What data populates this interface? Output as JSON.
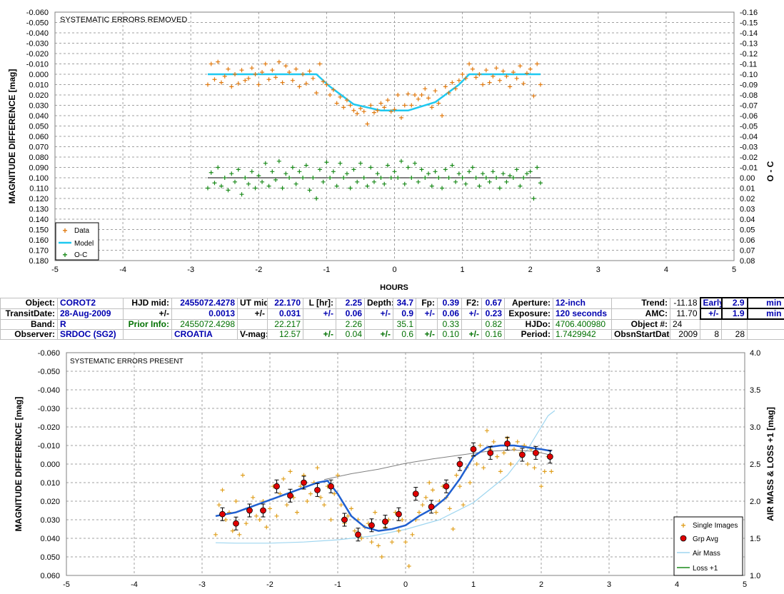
{
  "colors": {
    "data": "#e07a10",
    "model": "#1ec8f0",
    "oc": "#1a8a1a",
    "grpavg": "#e00000",
    "fit": "#2060d0",
    "airmass": "#9fd6f0",
    "loss": "#808080",
    "grid": "#a0a0a0"
  },
  "chart_data": [
    {
      "type": "scatter",
      "title": "SYSTEMATIC ERRORS REMOVED",
      "xlabel": "HOURS",
      "ylabel": "MAGNITUDE DIFFERENCE [mag]",
      "y2label": "O - C",
      "xlim": [
        -5,
        5
      ],
      "ylim": [
        -0.06,
        0.18
      ],
      "y_inverted": true,
      "y2lim": [
        -0.16,
        0.08
      ],
      "y2_inverted": true,
      "xticks": [
        "-5",
        "-4",
        "-3",
        "-2",
        "-1",
        "0",
        "1",
        "2",
        "3",
        "4",
        "5"
      ],
      "yticks": [
        "-0.060",
        "-0.050",
        "-0.040",
        "-0.030",
        "-0.020",
        "-0.010",
        "0.000",
        "0.010",
        "0.020",
        "0.030",
        "0.040",
        "0.050",
        "0.060",
        "0.070",
        "0.080",
        "0.090",
        "0.100",
        "0.110",
        "0.120",
        "0.130",
        "0.140",
        "0.150",
        "0.160",
        "0.170",
        "0.180"
      ],
      "y2ticks": [
        "-0.16",
        "-0.15",
        "-0.14",
        "-0.13",
        "-0.12",
        "-0.11",
        "-0.10",
        "-0.09",
        "-0.08",
        "-0.07",
        "-0.06",
        "-0.05",
        "-0.04",
        "-0.03",
        "-0.02",
        "-0.01",
        "0.00",
        "0.01",
        "0.02",
        "0.03",
        "0.04",
        "0.05",
        "0.06",
        "0.07",
        "0.08"
      ],
      "grid": true,
      "legend_position": "bottom-left",
      "legend": [
        "Data",
        "Model",
        "O-C"
      ],
      "model": {
        "name": "Model",
        "x": [
          -2.75,
          -1.15,
          -0.95,
          -0.6,
          -0.2,
          0.2,
          0.6,
          0.95,
          1.1,
          2.15
        ],
        "y": [
          0.0,
          0.0,
          0.012,
          0.029,
          0.035,
          0.035,
          0.027,
          0.01,
          0.0,
          0.0
        ]
      },
      "oc_baseline": {
        "x": [
          -2.75,
          2.15
        ],
        "y": [
          0.1,
          0.1
        ]
      },
      "series": [
        {
          "name": "Data",
          "x": [
            -2.75,
            -2.7,
            -2.65,
            -2.6,
            -2.55,
            -2.5,
            -2.45,
            -2.4,
            -2.35,
            -2.3,
            -2.25,
            -2.2,
            -2.15,
            -2.1,
            -2.05,
            -2.0,
            -1.95,
            -1.9,
            -1.85,
            -1.8,
            -1.75,
            -1.7,
            -1.65,
            -1.6,
            -1.55,
            -1.5,
            -1.45,
            -1.4,
            -1.35,
            -1.3,
            -1.25,
            -1.2,
            -1.15,
            -1.1,
            -1.05,
            -1.0,
            -0.95,
            -0.9,
            -0.85,
            -0.8,
            -0.75,
            -0.7,
            -0.65,
            -0.6,
            -0.55,
            -0.5,
            -0.45,
            -0.4,
            -0.35,
            -0.3,
            -0.25,
            -0.2,
            -0.15,
            -0.1,
            -0.05,
            0.0,
            0.05,
            0.1,
            0.15,
            0.2,
            0.25,
            0.3,
            0.35,
            0.4,
            0.45,
            0.5,
            0.55,
            0.6,
            0.65,
            0.7,
            0.75,
            0.8,
            0.85,
            0.9,
            0.95,
            1.0,
            1.05,
            1.1,
            1.15,
            1.2,
            1.25,
            1.3,
            1.35,
            1.4,
            1.45,
            1.5,
            1.55,
            1.6,
            1.65,
            1.7,
            1.75,
            1.8,
            1.85,
            1.9,
            1.95,
            2.0,
            2.05,
            2.1,
            2.15
          ],
          "y": [
            0.01,
            -0.01,
            0.005,
            -0.012,
            0.008,
            0.002,
            -0.005,
            0.012,
            0.0,
            0.009,
            -0.004,
            0.006,
            0.004,
            -0.006,
            0.0,
            0.01,
            -0.002,
            -0.01,
            0.005,
            -0.004,
            0.003,
            -0.012,
            0.008,
            -0.008,
            -0.002,
            0.006,
            -0.005,
            0.012,
            0.0,
            0.009,
            -0.003,
            0.004,
            0.018,
            -0.01,
            0.007,
            0.01,
            0.02,
            0.015,
            0.028,
            0.022,
            0.032,
            0.025,
            0.03,
            0.035,
            0.038,
            0.033,
            0.036,
            0.048,
            0.03,
            0.037,
            0.035,
            0.028,
            0.032,
            0.025,
            0.036,
            0.034,
            0.02,
            0.042,
            0.03,
            0.019,
            0.03,
            0.02,
            0.024,
            0.02,
            0.014,
            0.023,
            0.032,
            0.016,
            0.028,
            0.04,
            0.012,
            0.018,
            0.008,
            0.014,
            0.006,
            0.0,
            0.004,
            -0.01,
            -0.005,
            0.003,
            0.0,
            0.01,
            -0.004,
            0.008,
            0.002,
            -0.006,
            0.006,
            -0.003,
            0.002,
            0.012,
            -0.002,
            0.004,
            -0.008,
            0.009,
            -0.001,
            -0.005,
            0.021,
            -0.01,
            0.01
          ]
        },
        {
          "name": "O-C",
          "x": [
            -2.75,
            -2.7,
            -2.65,
            -2.6,
            -2.55,
            -2.5,
            -2.45,
            -2.4,
            -2.35,
            -2.3,
            -2.25,
            -2.2,
            -2.15,
            -2.1,
            -2.05,
            -2.0,
            -1.95,
            -1.9,
            -1.85,
            -1.8,
            -1.75,
            -1.7,
            -1.65,
            -1.6,
            -1.55,
            -1.5,
            -1.45,
            -1.4,
            -1.35,
            -1.3,
            -1.25,
            -1.2,
            -1.15,
            -1.1,
            -1.05,
            -1.0,
            -0.95,
            -0.9,
            -0.85,
            -0.8,
            -0.75,
            -0.7,
            -0.65,
            -0.6,
            -0.55,
            -0.5,
            -0.45,
            -0.4,
            -0.35,
            -0.3,
            -0.25,
            -0.2,
            -0.15,
            -0.1,
            -0.05,
            0.0,
            0.05,
            0.1,
            0.15,
            0.2,
            0.25,
            0.3,
            0.35,
            0.4,
            0.45,
            0.5,
            0.55,
            0.6,
            0.65,
            0.7,
            0.75,
            0.8,
            0.85,
            0.9,
            0.95,
            1.0,
            1.05,
            1.1,
            1.15,
            1.2,
            1.25,
            1.3,
            1.35,
            1.4,
            1.45,
            1.5,
            1.55,
            1.6,
            1.65,
            1.7,
            1.75,
            1.8,
            1.85,
            1.9,
            1.95,
            2.0,
            2.05,
            2.1,
            2.15
          ],
          "y": [
            0.11,
            0.095,
            0.105,
            0.09,
            0.108,
            0.1,
            0.112,
            0.096,
            0.104,
            0.092,
            0.116,
            0.1,
            0.106,
            0.094,
            0.11,
            0.098,
            0.104,
            0.086,
            0.108,
            0.094,
            0.102,
            0.084,
            0.11,
            0.096,
            0.1,
            0.09,
            0.106,
            0.094,
            0.1,
            0.088,
            0.112,
            0.1,
            0.12,
            0.092,
            0.104,
            0.085,
            0.1,
            0.094,
            0.108,
            0.086,
            0.1,
            0.096,
            0.11,
            0.092,
            0.104,
            0.086,
            0.1,
            0.108,
            0.09,
            0.104,
            0.096,
            0.1,
            0.106,
            0.088,
            0.1,
            0.094,
            0.1,
            0.084,
            0.106,
            0.09,
            0.1,
            0.086,
            0.104,
            0.092,
            0.1,
            0.096,
            0.108,
            0.094,
            0.1,
            0.11,
            0.092,
            0.1,
            0.088,
            0.104,
            0.096,
            0.1,
            0.106,
            0.094,
            0.09,
            0.1,
            0.108,
            0.096,
            0.1,
            0.104,
            0.094,
            0.1,
            0.11,
            0.096,
            0.104,
            0.098,
            0.1,
            0.092,
            0.108,
            0.1,
            0.096,
            0.094,
            0.12,
            0.09,
            0.105
          ]
        }
      ]
    },
    {
      "type": "scatter",
      "title": "SYSTEMATIC ERRORS PRESENT",
      "xlabel": "",
      "ylabel": "MAGNITUDE DIFFERENCE [mag]",
      "y2label": "AIR MASS & LOSS +1 [mag]",
      "xlim": [
        -5,
        5
      ],
      "ylim": [
        -0.06,
        0.06
      ],
      "y_inverted": true,
      "y2lim": [
        1.0,
        4.0
      ],
      "xticks": [
        "-5",
        "-4",
        "-3",
        "-2",
        "-1",
        "0",
        "1",
        "2",
        "3",
        "4",
        "5"
      ],
      "yticks": [
        "-0.060",
        "-0.050",
        "-0.040",
        "-0.030",
        "-0.020",
        "-0.010",
        "0.000",
        "0.010",
        "0.020",
        "0.030",
        "0.040",
        "0.050",
        "0.060"
      ],
      "y2ticks": [
        "4.0",
        "3.5",
        "3.0",
        "2.5",
        "2.0",
        "1.5",
        "1.0"
      ],
      "grid": true,
      "legend_position": "bottom-right",
      "legend": [
        "Single Images",
        "Grp Avg",
        "Air Mass",
        "Loss +1"
      ],
      "series": [
        {
          "name": "Single Images",
          "x": [
            -2.8,
            -2.75,
            -2.7,
            -2.65,
            -2.6,
            -2.55,
            -2.5,
            -2.45,
            -2.4,
            -2.35,
            -2.3,
            -2.25,
            -2.2,
            -2.15,
            -2.1,
            -2.05,
            -2.0,
            -1.95,
            -1.9,
            -1.85,
            -1.8,
            -1.75,
            -1.7,
            -1.65,
            -1.6,
            -1.55,
            -1.5,
            -1.45,
            -1.4,
            -1.35,
            -1.3,
            -1.25,
            -1.2,
            -1.15,
            -1.1,
            -1.05,
            -1.0,
            -0.95,
            -0.9,
            -0.85,
            -0.8,
            -0.75,
            -0.7,
            -0.65,
            -0.6,
            -0.55,
            -0.5,
            -0.45,
            -0.4,
            -0.35,
            -0.3,
            -0.25,
            -0.2,
            -0.15,
            -0.1,
            -0.05,
            0.0,
            0.05,
            0.1,
            0.15,
            0.2,
            0.25,
            0.3,
            0.35,
            0.4,
            0.45,
            0.5,
            0.55,
            0.6,
            0.65,
            0.7,
            0.75,
            0.8,
            0.85,
            0.9,
            0.95,
            1.0,
            1.05,
            1.1,
            1.15,
            1.2,
            1.25,
            1.3,
            1.35,
            1.4,
            1.45,
            1.5,
            1.55,
            1.6,
            1.65,
            1.7,
            1.75,
            1.8,
            1.85,
            1.9,
            1.95,
            2.0,
            2.05,
            2.1,
            2.15
          ],
          "y": [
            0.038,
            0.022,
            0.014,
            0.03,
            0.026,
            0.036,
            0.02,
            0.038,
            0.006,
            0.032,
            0.024,
            0.018,
            0.028,
            0.03,
            0.02,
            0.034,
            0.024,
            0.012,
            0.028,
            0.016,
            0.008,
            0.022,
            0.004,
            0.018,
            0.026,
            0.012,
            0.006,
            0.02,
            0.016,
            0.01,
            0.002,
            0.018,
            0.022,
            0.012,
            0.03,
            0.016,
            0.006,
            0.022,
            0.032,
            0.028,
            0.024,
            0.036,
            0.03,
            0.04,
            0.034,
            0.032,
            0.042,
            0.026,
            0.044,
            0.05,
            0.034,
            0.03,
            0.042,
            0.026,
            0.036,
            0.03,
            0.042,
            0.055,
            0.038,
            0.03,
            0.026,
            0.022,
            0.018,
            0.01,
            0.014,
            0.026,
            0.02,
            0.012,
            0.018,
            0.024,
            0.035,
            0.006,
            0.012,
            0.022,
            0.002,
            0.01,
            -0.004,
            0.0,
            -0.01,
            0.002,
            -0.018,
            -0.008,
            -0.012,
            -0.004,
            0.004,
            -0.006,
            -0.014,
            0.0,
            -0.008,
            -0.012,
            -0.006,
            -0.01,
            0.0,
            -0.008,
            0.002,
            -0.006,
            0.012,
            0.004,
            -0.004,
            0.004
          ]
        },
        {
          "name": "Grp Avg",
          "x": [
            -2.7,
            -2.5,
            -2.3,
            -2.1,
            -1.9,
            -1.7,
            -1.5,
            -1.3,
            -1.1,
            -0.9,
            -0.7,
            -0.5,
            -0.3,
            -0.1,
            0.15,
            0.38,
            0.6,
            0.8,
            1.0,
            1.25,
            1.5,
            1.72,
            1.92,
            2.13
          ],
          "y": [
            0.027,
            0.032,
            0.025,
            0.025,
            0.012,
            0.017,
            0.01,
            0.014,
            0.012,
            0.03,
            0.038,
            0.033,
            0.031,
            0.027,
            0.016,
            0.023,
            0.012,
            0.0,
            -0.008,
            -0.006,
            -0.011,
            -0.005,
            -0.006,
            -0.004
          ]
        },
        {
          "name": "Fit",
          "x": [
            -2.8,
            -2.5,
            -2.2,
            -1.9,
            -1.6,
            -1.3,
            -1.15,
            -1.0,
            -0.8,
            -0.6,
            -0.4,
            -0.2,
            0.0,
            0.2,
            0.4,
            0.6,
            0.8,
            1.0,
            1.2,
            1.4,
            1.6,
            1.8,
            2.0,
            2.15
          ],
          "y": [
            0.028,
            0.026,
            0.022,
            0.018,
            0.014,
            0.01,
            0.009,
            0.016,
            0.028,
            0.034,
            0.036,
            0.035,
            0.033,
            0.028,
            0.024,
            0.018,
            0.008,
            -0.004,
            -0.009,
            -0.01,
            -0.01,
            -0.009,
            -0.008,
            -0.007
          ]
        },
        {
          "name": "Air Mass",
          "x": [
            -2.8,
            -2.5,
            -2.0,
            -1.5,
            -1.0,
            -0.5,
            0.0,
            0.5,
            1.0,
            1.5,
            1.8,
            2.0,
            2.1,
            2.2
          ],
          "y": [
            1.44,
            1.435,
            1.435,
            1.45,
            1.48,
            1.53,
            1.62,
            1.75,
            1.98,
            2.35,
            2.7,
            3.0,
            3.15,
            3.22
          ]
        },
        {
          "name": "Loss +1",
          "x": [
            -1.2,
            -0.8,
            -0.4,
            0.0,
            0.4,
            0.8,
            1.2,
            1.6,
            1.9,
            2.1
          ],
          "y": [
            2.29,
            2.37,
            2.43,
            2.51,
            2.57,
            2.62,
            2.67,
            2.69,
            2.67,
            2.63
          ]
        }
      ]
    }
  ],
  "info_table": {
    "rows": [
      [
        "Object:",
        "COROT2",
        "HJD mid:",
        "2455072.4278",
        "UT mid:",
        "22.170",
        "L [hr]:",
        "2.25",
        "Depth:",
        "34.7",
        "Fp:",
        "0.39",
        "F2:",
        "0.67",
        "Aperture:",
        "12-inch",
        "Trend:",
        "-11.18",
        "Early:",
        "2.9",
        "min"
      ],
      [
        "TransitDate:",
        "28-Aug-2009",
        "+/-",
        "0.0013",
        "+/-",
        "0.031",
        "+/-",
        "0.06",
        "+/-",
        "0.9",
        "+/-",
        "0.06",
        "+/-",
        "0.23",
        "Exposure:",
        "120 seconds",
        "AMC:",
        "11.70",
        "+/-",
        "1.9",
        "min"
      ],
      [
        "Band:",
        "R",
        "Prior Info:",
        "2455072.4298",
        "",
        "22.217",
        "",
        "2.26",
        "",
        "35.1",
        "",
        "0.33",
        "",
        "0.82",
        "HJDo:",
        "4706.400980",
        "Object #:",
        "24",
        "",
        "",
        ""
      ],
      [
        "Observer:",
        "SRDOC (SG2)",
        "",
        "CROATIA",
        "V-mag:",
        "12.57",
        "+/-",
        "0.04",
        "+/-",
        "0.6",
        "+/-",
        "0.10",
        "+/-",
        "0.16",
        "Period:",
        "1.7429942",
        "ObsnStartDate:",
        "2009",
        "8",
        "28",
        ""
      ]
    ]
  }
}
